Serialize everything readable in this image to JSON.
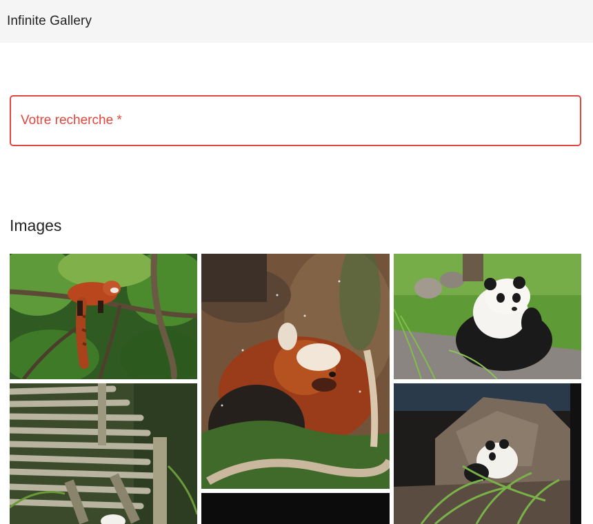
{
  "app": {
    "title": "Infinite Gallery"
  },
  "search": {
    "label": "Votre recherche *",
    "value": "",
    "accent_color": "#e2453b"
  },
  "gallery": {
    "title": "Images",
    "images": [
      {
        "subject": "red panda on tree branch"
      },
      {
        "subject": "red panda in snow"
      },
      {
        "subject": "giant panda sitting on grass"
      },
      {
        "subject": "bamboo log structure with panda"
      },
      {
        "subject": "giant panda eating bamboo on rocks"
      },
      {
        "subject": "dark image"
      }
    ]
  }
}
